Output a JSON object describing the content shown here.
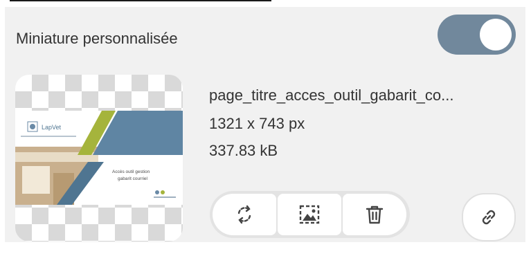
{
  "settings": {
    "title": "Miniature personnalisée",
    "toggle_on": true,
    "toggle_color": "#71889c"
  },
  "thumbnail": {
    "image_texts": {
      "brand": "LapVet",
      "caption_line1": "Accès outil gestion",
      "caption_line2": "gabarit courriel"
    },
    "colors": {
      "accent_green": "#a5b43c",
      "accent_blue": "#5f85a3"
    }
  },
  "file": {
    "name": "page_titre_acces_outil_gabarit_co...",
    "dimensions": "1321 x 743 px",
    "size": "337.83 kB"
  },
  "actions": {
    "replace_icon": "refresh-icon",
    "edit_icon": "image-crop-icon",
    "delete_icon": "trash-icon",
    "link_icon": "link-icon"
  }
}
